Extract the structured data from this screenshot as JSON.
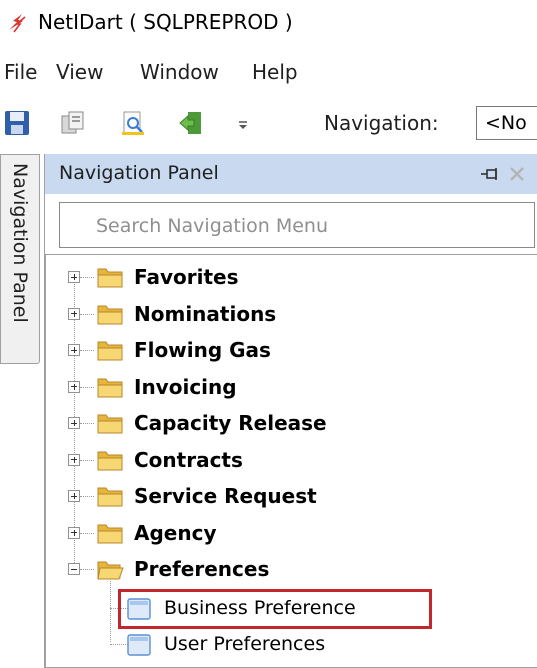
{
  "window": {
    "title": "NetIDart ( SQLPREPROD )"
  },
  "menu": [
    "File",
    "View",
    "Window",
    "Help"
  ],
  "toolbar": {
    "icons": [
      "save-icon",
      "copy-icon",
      "print-preview-icon",
      "exit-icon",
      "toolbar-overflow-icon"
    ],
    "navigation_label": "Navigation:",
    "navigation_value": "<No"
  },
  "side_tab": {
    "label": "Navigation Panel"
  },
  "panel": {
    "title": "Navigation Panel",
    "search_placeholder": "Search Navigation Menu",
    "tree": [
      {
        "label": "Favorites",
        "expanded": false
      },
      {
        "label": "Nominations",
        "expanded": false
      },
      {
        "label": "Flowing Gas",
        "expanded": false
      },
      {
        "label": "Invoicing",
        "expanded": false
      },
      {
        "label": "Capacity Release",
        "expanded": false
      },
      {
        "label": "Contracts",
        "expanded": false
      },
      {
        "label": "Service Request",
        "expanded": false
      },
      {
        "label": "Agency",
        "expanded": false
      },
      {
        "label": "Preferences",
        "expanded": true,
        "children": [
          "Business Preference",
          "User Preferences"
        ]
      }
    ],
    "highlighted_item": "Business Preference"
  },
  "colors": {
    "panel_header": "#c9daf0",
    "highlight_border": "#c0282d",
    "folder": "#f2c94c"
  }
}
